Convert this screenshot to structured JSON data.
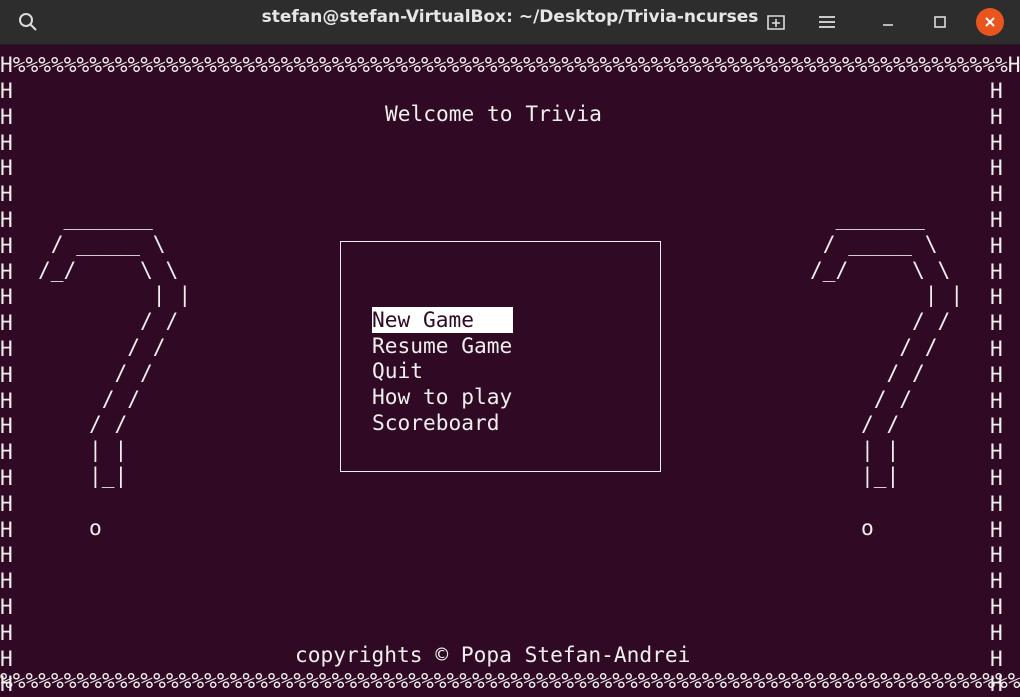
{
  "window": {
    "title": "stefan@stefan-VirtualBox: ~/Desktop/Trivia-ncurses",
    "icons": {
      "search": "search-icon",
      "new_tab": "new-tab-icon",
      "menu": "hamburger-menu-icon",
      "minimize": "minimize-icon",
      "maximize": "maximize-icon",
      "close": "close-icon"
    },
    "colors": {
      "titlebar_bg": "#2d2d2d",
      "close_button": "#e9541f",
      "terminal_bg": "#300a24",
      "terminal_fg": "#eeeeec"
    }
  },
  "terminal": {
    "border_top": "H%%%%%%%%%%%%%%%%%%%%%%%%%%%%%%%%%%%%%%%%%%%%%%%%%%%%%%%%%%%%%%%%%%%%%%%%%%%%%%H",
    "border_bottom": "%%%%%%%%%%%%%%%%%%%%%%%%%%%%%%%%%%%%%%%%%%%%%%%%%%%%%%%%%%%%%%%%%%%%%%%%%%%%%%%%",
    "border_side": "H\nH\nH\nH\nH\nH\nH\nH\nH\nH\nH\nH\nH\nH\nH\nH\nH\nH\nH\nH\nH\nH\nH\nH",
    "welcome": "Welcome to Trivia",
    "question_mark_art": "  _______\n / _____ \\\n/_/     \\ \\\n         | |\n        / /\n       / /\n      / /\n     / /\n    / /\n    | |\n    |_|\n\n    o",
    "menu": {
      "items": [
        "New Game",
        "Resume Game",
        "Quit",
        "How to play",
        "Scoreboard"
      ],
      "selected_index": 0
    },
    "copyright": "copyrights © Popa Stefan-Andrei"
  }
}
